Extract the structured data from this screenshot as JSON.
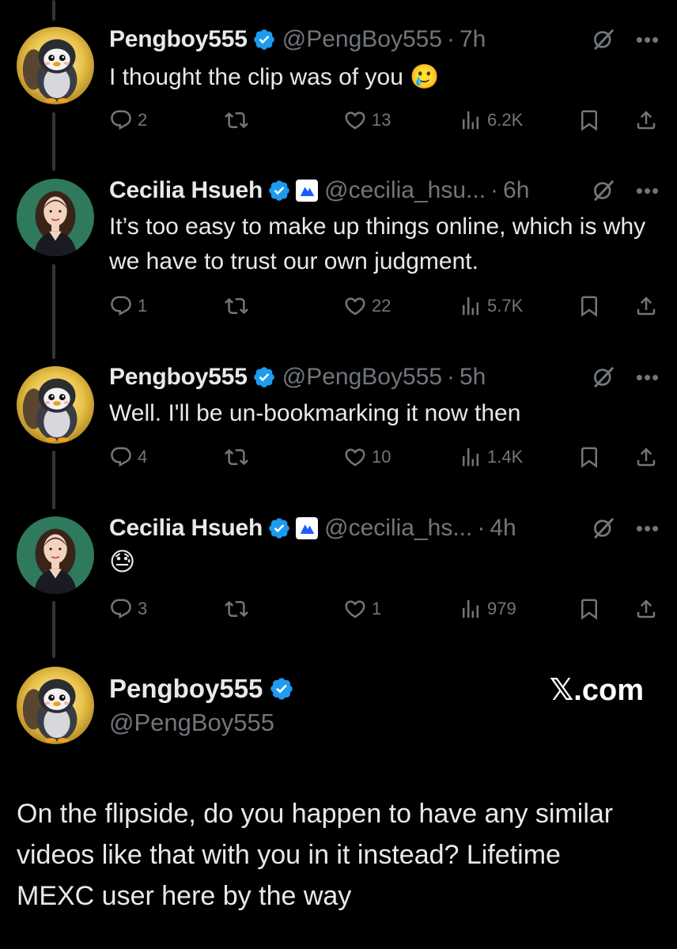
{
  "tweets": [
    {
      "name": "Pengboy555",
      "handle": "@PengBoy555",
      "time": "7h",
      "text": "I thought the clip was of you 🥲",
      "replies": "2",
      "retweets": "",
      "likes": "13",
      "views": "6.2K",
      "avatar": "penguin"
    },
    {
      "name": "Cecilia Hsueh",
      "handle": "@cecilia_hsu...",
      "time": "6h",
      "text": "It’s too easy to make up things online, which is why we have to trust our own judgment.",
      "replies": "1",
      "retweets": "",
      "likes": "22",
      "views": "5.7K",
      "avatar": "woman"
    },
    {
      "name": "Pengboy555",
      "handle": "@PengBoy555",
      "time": "5h",
      "text": "Well. I'll be un-bookmarking it now then",
      "replies": "4",
      "retweets": "",
      "likes": "10",
      "views": "1.4K",
      "avatar": "penguin"
    },
    {
      "name": "Cecilia Hsueh",
      "handle": "@cecilia_hs...",
      "time": "4h",
      "text": "😓",
      "replies": "3",
      "retweets": "",
      "likes": "1",
      "views": "979",
      "avatar": "woman"
    }
  ],
  "final": {
    "name": "Pengboy555",
    "handle": "@PengBoy555",
    "site": "𝕏.com",
    "text": "On the flipside, do you happen to have any similar videos like that with you in it instead? Lifetime MEXC user here by the way"
  },
  "colors": {
    "background": "#000000",
    "text": "#e7e9ea",
    "muted": "#71767b",
    "verified": "#1d9bf0",
    "affiliate": "#1a5cff"
  },
  "icons": [
    "reply-icon",
    "retweet-icon",
    "like-icon",
    "views-icon",
    "bookmark-icon",
    "share-icon",
    "grok-icon",
    "more-icon",
    "verified-icon",
    "affiliate-badge-icon"
  ]
}
